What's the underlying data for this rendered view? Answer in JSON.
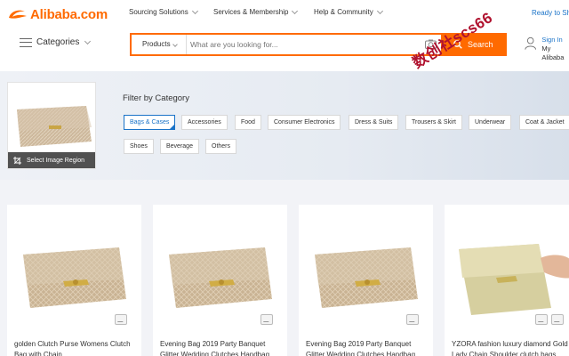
{
  "brand": {
    "logo_text": "Alibaba.com",
    "accent": "#ff6a00"
  },
  "nav": {
    "sourcing": "Sourcing Solutions",
    "services": "Services & Membership",
    "help": "Help & Community",
    "ready": "Ready to Ship"
  },
  "categories_label": "Categories",
  "search": {
    "type_label": "Products",
    "placeholder": "What are you looking for...",
    "button_label": "Search"
  },
  "account": {
    "sign_in": "Sign In",
    "my": "My Alibaba"
  },
  "image_search": {
    "overlay_label": "Select Image Region"
  },
  "filter": {
    "title": "Filter by Category",
    "chips": [
      "Bags & Cases",
      "Accessories",
      "Food",
      "Consumer Electronics",
      "Dress & Suits",
      "Trousers & Skirt",
      "Underwear",
      "Coat & Jacket",
      "Shoes",
      "Beverage",
      "Others"
    ]
  },
  "watermark": "数创社scs66",
  "products": [
    {
      "title": "golden Clutch Purse Womens Clutch Bag with Chain"
    },
    {
      "title": "Evening Bag 2019 Party Banquet Glitter Wedding Clutches Handbag"
    },
    {
      "title": "Evening Bag 2019 Party Banquet Glitter Wedding Clutches Handbag"
    },
    {
      "title": "YZORA fashion luxury diamond Gold Lady Chain Shoulder clutch bags"
    }
  ]
}
